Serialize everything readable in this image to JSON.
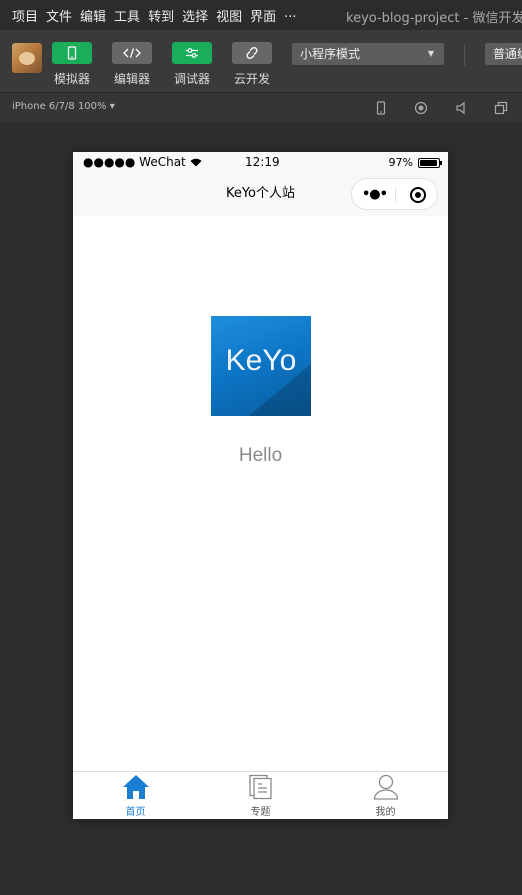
{
  "menubar": {
    "items": [
      "项目",
      "文件",
      "编辑",
      "工具",
      "转到",
      "选择",
      "视图",
      "界面",
      "..."
    ],
    "window_title": "keyo-blog-project - 微信开发者"
  },
  "toolbar": {
    "simulator_label": "模拟器",
    "editor_label": "编辑器",
    "debugger_label": "调试器",
    "cloud_label": "云开发",
    "mode_value": "小程序模式",
    "compile_value": "普通编"
  },
  "simbar": {
    "device_value": "iPhone 6/7/8 100% ▾"
  },
  "phone": {
    "statusbar": {
      "carrier": "●●●●● WeChat",
      "time": "12:19",
      "battery_percent": "97%",
      "battery_level": 0.97
    },
    "navbar": {
      "title": "KeYo个人站"
    },
    "content": {
      "logo_text": "KeYo",
      "greeting": "Hello"
    },
    "tabbar": {
      "tabs": [
        {
          "label": "首页",
          "icon": "home-icon",
          "active": true
        },
        {
          "label": "专题",
          "icon": "topics-icon",
          "active": false
        },
        {
          "label": "我的",
          "icon": "user-icon",
          "active": false
        }
      ]
    }
  },
  "colors": {
    "accent_green": "#1aad5a",
    "tab_active": "#1a7fd4",
    "tab_inactive": "#8a8a8a",
    "ide_background": "#2e2e2e"
  }
}
